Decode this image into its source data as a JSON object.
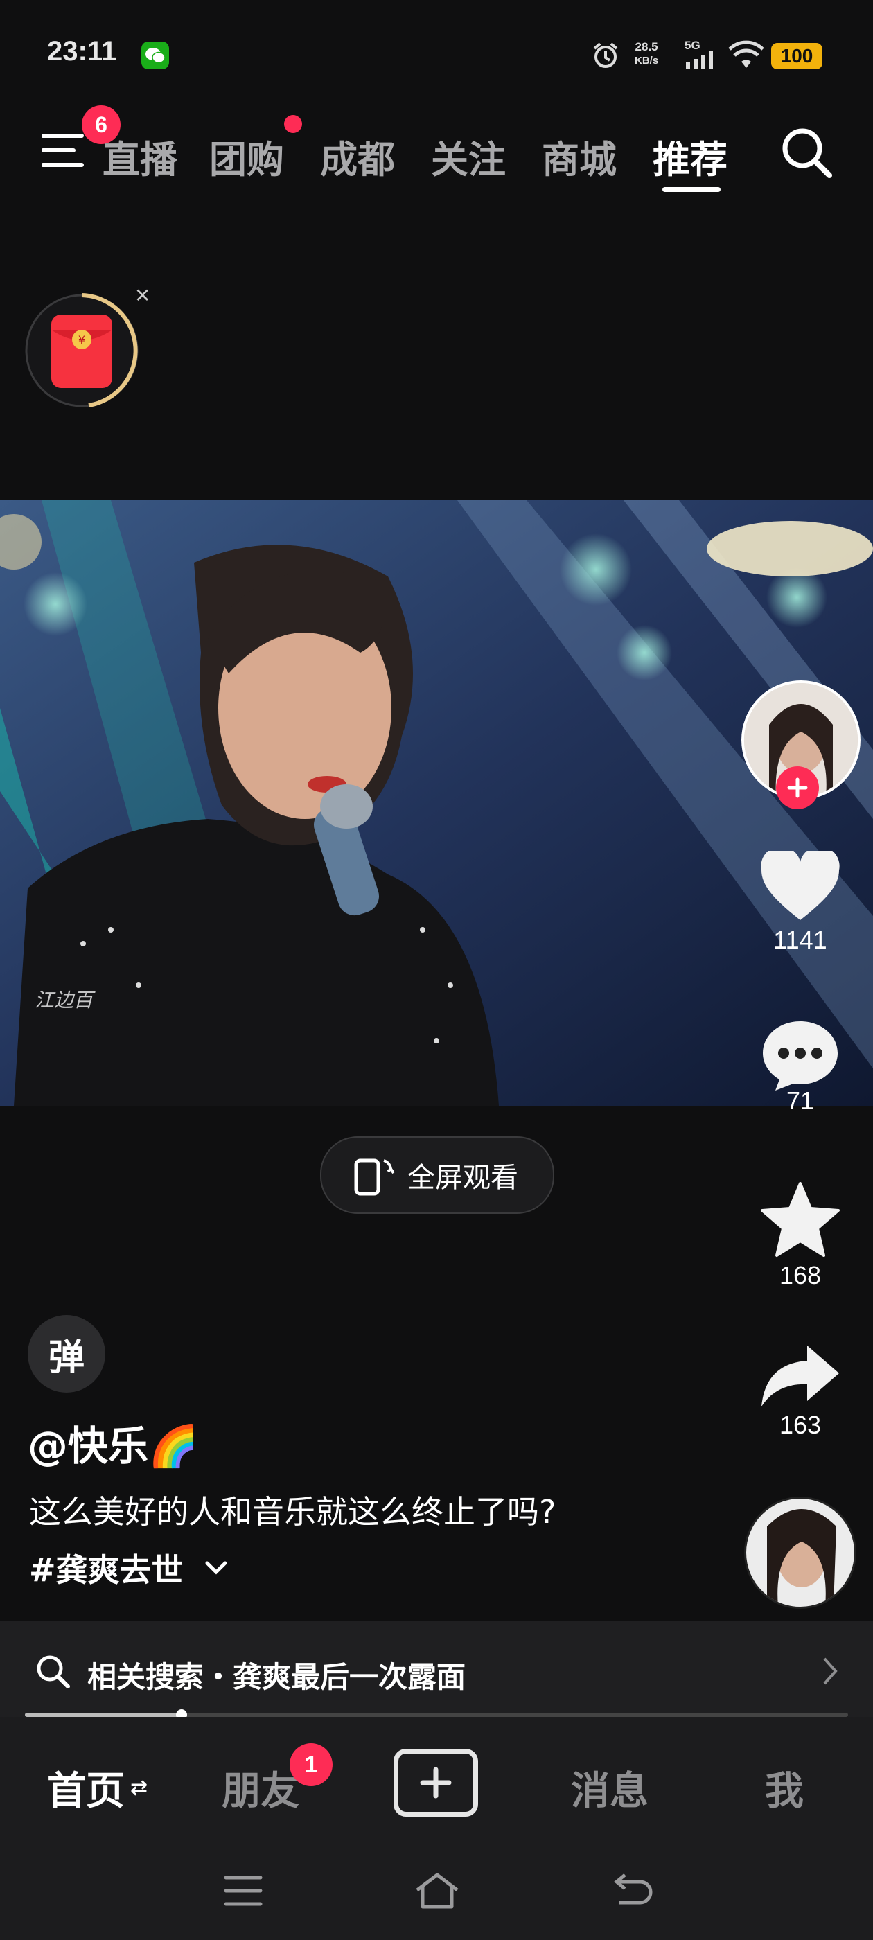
{
  "status_bar": {
    "time": "23:11",
    "net_speed": "28.5",
    "net_unit": "KB/s",
    "net_type": "5G",
    "battery": "100"
  },
  "top_nav": {
    "menu_badge": "6",
    "tabs": [
      {
        "label": "直播"
      },
      {
        "label": "团购"
      },
      {
        "label": "成都"
      },
      {
        "label": "关注"
      },
      {
        "label": "商城"
      },
      {
        "label": "推荐"
      }
    ],
    "active_tab": "推荐"
  },
  "video": {
    "watermark": "江边百",
    "fullscreen_label": "全屏观看"
  },
  "side_actions": {
    "likes": "1141",
    "comments": "71",
    "favorites": "168",
    "shares": "163"
  },
  "post": {
    "danmaku_label": "弹",
    "author": "@快乐🌈",
    "caption": "这么美好的人和音乐就这么终止了吗?",
    "hashtag": "#龚爽去世"
  },
  "related_search": {
    "label": "相关搜索・龚爽最后一次露面",
    "progress": 0.19
  },
  "bottom_nav": {
    "home": "首页",
    "friends": "朋友",
    "friends_badge": "1",
    "messages": "消息",
    "me": "我"
  },
  "colors": {
    "background": "#0f0f10",
    "accent": "#fe2c55",
    "battery": "#f3b20c"
  },
  "icons": [
    "wechat-icon",
    "alarm-icon",
    "signal-icon",
    "wifi-icon",
    "menu-icon",
    "search-icon",
    "red-packet-icon",
    "heart-icon",
    "comment-icon",
    "star-icon",
    "share-icon",
    "rotate-screen-icon",
    "add-icon",
    "nav-menu-icon",
    "nav-home-icon",
    "nav-back-icon"
  ]
}
